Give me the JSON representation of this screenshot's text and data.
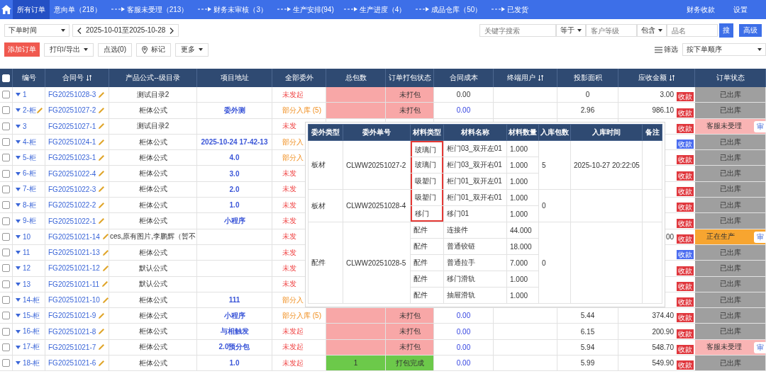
{
  "nav": {
    "tabs": [
      {
        "label": "所有订单",
        "selected": true,
        "arrow_before": false
      },
      {
        "label": "意向单（218）",
        "selected": false,
        "arrow_before": false
      },
      {
        "label": "客服未受理（213）",
        "selected": false,
        "arrow_before": true
      },
      {
        "label": "财务未审核（3）",
        "selected": false,
        "arrow_before": true
      },
      {
        "label": "生产安排(94)",
        "selected": false,
        "arrow_before": true
      },
      {
        "label": "生产进度（4）",
        "selected": false,
        "arrow_before": true
      },
      {
        "label": "成品仓库（50）",
        "selected": false,
        "arrow_before": true
      },
      {
        "label": "已发货",
        "selected": false,
        "arrow_before": true
      }
    ],
    "right_links": [
      "财务收款",
      "设置"
    ]
  },
  "filters": {
    "time_select": "下单时间",
    "date_range": "2025-10-01至2025-10-28",
    "keyword_placeholder": "关键字搜索",
    "op1": "等于",
    "level_placeholder": "客户等级",
    "op2": "包含",
    "name_placeholder": "品名",
    "search_button": "搜",
    "advanced_button": "高级"
  },
  "actions": {
    "add": "添加订单",
    "print": "打印/导出",
    "pick": "点选(0)",
    "mark": "标记",
    "more": "更多",
    "filter": "筛选",
    "sort": "按下单顺序"
  },
  "table": {
    "all_checked": false,
    "columns": [
      {
        "label": "编号",
        "sortable": false
      },
      {
        "label": "合同号",
        "sortable": true
      },
      {
        "label": "产品公式--级目录",
        "sortable": false
      },
      {
        "label": "项目地址",
        "sortable": false
      },
      {
        "label": "全部委外",
        "sortable": false
      },
      {
        "label": "总包数",
        "sortable": false
      },
      {
        "label": "订单打包状态",
        "sortable": false
      },
      {
        "label": "合同成本",
        "sortable": false
      },
      {
        "label": "终端用户",
        "sortable": true
      },
      {
        "label": "投影面积",
        "sortable": false
      },
      {
        "label": "应收金额",
        "sortable": true
      },
      {
        "label": "订单状态",
        "sortable": false
      }
    ],
    "rows": [
      {
        "checked": false,
        "no": "1",
        "editable": false,
        "contract": "FG20251028-3",
        "formula": "测试目录2",
        "outsource": {
          "text": "未发起",
          "kind": "pending"
        },
        "packages": {
          "kind": "unpacked"
        },
        "pack": {
          "text": "未打包",
          "kind": "unpacked"
        },
        "cost": {
          "text": "0.00",
          "kind": "plain"
        },
        "area": "0",
        "amount": "3.00",
        "pay": {
          "text": "收款",
          "color": "#e0383e"
        },
        "status": {
          "text": "已出库",
          "kind": "shipped"
        }
      },
      {
        "checked": false,
        "no": "2-柜",
        "editable": true,
        "contract": "FG20251027-2",
        "formula": "柜体公式",
        "address": "委外测",
        "outsource": {
          "text": "部分入库 (5)",
          "kind": "partial"
        },
        "packages": {
          "kind": "unpacked"
        },
        "pack": {
          "text": "未打包",
          "kind": "unpacked"
        },
        "cost": {
          "text": "0.00",
          "kind": "link"
        },
        "area": "2.96",
        "amount": "986.10",
        "pay": {
          "text": "收款",
          "color": "#e0383e"
        },
        "status": {
          "text": "已出库",
          "kind": "shipped"
        }
      },
      {
        "checked": false,
        "no": "3",
        "editable": false,
        "contract": "FG20251027-1",
        "formula": "测试目录2",
        "outsource": {
          "text": "未发",
          "kind": "pending"
        },
        "pay": {
          "text": "收款",
          "color": "#e0383e"
        },
        "status": {
          "text": "客服未受理",
          "kind": "waiting"
        },
        "action": "审"
      },
      {
        "checked": false,
        "no": "4-柜",
        "editable": false,
        "contract": "FG20251024-1",
        "formula": "柜体公式",
        "address": "2025-10-24 17-42-13",
        "outsource": {
          "text": "部分入",
          "kind": "partial"
        },
        "pay": {
          "text": "收款",
          "color": "#4a6cf0"
        },
        "status": {
          "text": "已出库",
          "kind": "shipped"
        }
      },
      {
        "checked": false,
        "no": "5-柜",
        "editable": false,
        "contract": "FG20251023-1",
        "formula": "柜体公式",
        "address": "4.0",
        "outsource": {
          "text": "部分入",
          "kind": "partial"
        },
        "pay": {
          "text": "收款",
          "color": "#e0383e"
        },
        "status": {
          "text": "已出库",
          "kind": "shipped"
        }
      },
      {
        "checked": false,
        "no": "6-柜",
        "editable": false,
        "contract": "FG20251022-4",
        "formula": "柜体公式",
        "address": "3.0",
        "outsource": {
          "text": "未发",
          "kind": "pending"
        },
        "pay": {
          "text": "收款",
          "color": "#e0383e"
        },
        "status": {
          "text": "已出库",
          "kind": "shipped"
        }
      },
      {
        "checked": false,
        "no": "7-柜",
        "editable": false,
        "contract": "FG20251022-3",
        "formula": "柜体公式",
        "address": "2.0",
        "outsource": {
          "text": "未发",
          "kind": "pending"
        },
        "pay": {
          "text": "收款",
          "color": "#e0383e"
        },
        "status": {
          "text": "已出库",
          "kind": "shipped"
        }
      },
      {
        "checked": false,
        "no": "8-柜",
        "editable": false,
        "contract": "FG20251022-2",
        "formula": "柜体公式",
        "address": "1.0",
        "outsource": {
          "text": "未发",
          "kind": "pending"
        },
        "pay": {
          "text": "收款",
          "color": "#e0383e"
        },
        "status": {
          "text": "已出库",
          "kind": "shipped"
        }
      },
      {
        "checked": false,
        "no": "9-柜",
        "editable": false,
        "contract": "FG20251022-1",
        "formula": "柜体公式",
        "address": "小程序",
        "outsource": {
          "text": "未发",
          "kind": "pending"
        },
        "pay": {
          "text": "收款",
          "color": "#e0383e"
        },
        "status": {
          "text": "已出库",
          "kind": "shipped"
        }
      },
      {
        "checked": false,
        "no": "10",
        "editable": false,
        "contract": "FG20251021-14",
        "formula": "ces,原有图片,李鹏辉（暂不",
        "outsource": {
          "text": "未发",
          "kind": "pending"
        },
        "amount": "00",
        "pay": {
          "text": "收款",
          "color": "#e0383e"
        },
        "status": {
          "text": "正在生产",
          "kind": "producing"
        },
        "action": "审"
      },
      {
        "checked": false,
        "no": "11",
        "editable": false,
        "contract": "FG20251021-13",
        "formula": "柜体公式",
        "outsource": {
          "text": "未发",
          "kind": "pending"
        },
        "pay": {
          "text": "收款",
          "color": "#4a6cf0"
        },
        "status": {
          "text": "已出库",
          "kind": "shipped"
        }
      },
      {
        "checked": false,
        "no": "12",
        "editable": false,
        "contract": "FG20251021-12",
        "formula": "默认公式",
        "outsource": {
          "text": "未发",
          "kind": "pending"
        },
        "pay": {
          "text": "收款",
          "color": "#e0383e"
        },
        "status": {
          "text": "已出库",
          "kind": "shipped"
        }
      },
      {
        "checked": false,
        "no": "13",
        "editable": false,
        "contract": "FG20251021-11",
        "formula": "默认公式",
        "outsource": {
          "text": "未发",
          "kind": "pending"
        },
        "pay": {
          "text": "收款",
          "color": "#e0383e"
        },
        "status": {
          "text": "已出库",
          "kind": "shipped"
        }
      },
      {
        "checked": false,
        "no": "14-柜",
        "editable": false,
        "contract": "FG20251021-10",
        "formula": "柜体公式",
        "address": "111",
        "outsource": {
          "text": "部分入",
          "kind": "partial"
        },
        "pay": {
          "text": "收款",
          "color": "#e0383e"
        },
        "status": {
          "text": "已出库",
          "kind": "shipped"
        }
      },
      {
        "checked": false,
        "no": "15-柜",
        "editable": false,
        "contract": "FG20251021-9",
        "formula": "柜体公式",
        "address": "小程序",
        "outsource": {
          "text": "部分入库 (5)",
          "kind": "partial"
        },
        "packages": {
          "kind": "unpacked"
        },
        "pack": {
          "text": "未打包",
          "kind": "unpacked"
        },
        "cost": {
          "text": "0.00",
          "kind": "link"
        },
        "area": "5.44",
        "amount": "374.40",
        "pay": {
          "text": "收款",
          "color": "#e0383e"
        },
        "status": {
          "text": "已出库",
          "kind": "shipped"
        }
      },
      {
        "checked": false,
        "no": "16-柜",
        "editable": false,
        "contract": "FG20251021-8",
        "formula": "柜体公式",
        "address": "与相触发",
        "outsource": {
          "text": "未发起",
          "kind": "pending"
        },
        "packages": {
          "kind": "unpacked"
        },
        "pack": {
          "text": "未打包",
          "kind": "unpacked"
        },
        "cost": {
          "text": "0.00",
          "kind": "link"
        },
        "area": "6.15",
        "amount": "200.90",
        "pay": {
          "text": "收款",
          "color": "#e0383e"
        },
        "status": {
          "text": "已出库",
          "kind": "shipped"
        }
      },
      {
        "checked": false,
        "no": "17-柜",
        "editable": false,
        "contract": "FG20251021-7",
        "formula": "柜体公式",
        "address": "2.0预分包",
        "outsource": {
          "text": "未发起",
          "kind": "pending"
        },
        "packages": {
          "kind": "unpacked"
        },
        "pack": {
          "text": "未打包",
          "kind": "unpacked"
        },
        "cost": {
          "text": "0.00",
          "kind": "link"
        },
        "area": "5.94",
        "amount": "548.70",
        "pay": {
          "text": "收款",
          "color": "#e0383e"
        },
        "status": {
          "text": "客服未受理",
          "kind": "waiting"
        },
        "action": "审"
      },
      {
        "checked": false,
        "no": "18-柜",
        "editable": false,
        "contract": "FG20251021-6",
        "formula": "柜体公式",
        "address": "1.0",
        "outsource": {
          "text": "未发起",
          "kind": "pending"
        },
        "packages": {
          "text": "1",
          "kind": "packed"
        },
        "pack": {
          "text": "打包完成",
          "kind": "packed"
        },
        "cost": {
          "text": "0.00",
          "kind": "link"
        },
        "area": "5.99",
        "amount": "549.90",
        "pay": {
          "text": "收款",
          "color": "#e0383e"
        },
        "status": {
          "text": "已出库",
          "kind": "shipped"
        }
      }
    ]
  },
  "outsource_popup": {
    "columns": [
      "委外类型",
      "委外单号",
      "材料类型",
      "材料名称",
      "材料数量",
      "入库包数",
      "入库时间",
      "备注"
    ],
    "groups": [
      {
        "type": "板材",
        "order": "CLWW20251027-2",
        "packages": "5",
        "time": "2025-10-27 20:22:05",
        "items": [
          {
            "material_type": "玻璃门",
            "name": "柜门03_双开左01",
            "qty": "1.000",
            "highlighted": true
          },
          {
            "material_type": "玻璃门",
            "name": "柜门03_双开右01",
            "qty": "1.000",
            "highlighted": true
          },
          {
            "material_type": "吸塑门",
            "name": "柜门01_双开左01",
            "qty": "1.000",
            "highlighted": true
          }
        ]
      },
      {
        "type": "板材",
        "order": "CLWW20251028-4",
        "packages": "0",
        "items": [
          {
            "material_type": "吸塑门",
            "name": "柜门01_双开右01",
            "qty": "1.000",
            "highlighted": true
          },
          {
            "material_type": "移门",
            "name": "移门01",
            "qty": "1.000",
            "highlighted": true
          }
        ]
      },
      {
        "type": "配件",
        "order": "CLWW20251028-5",
        "packages": "0",
        "items": [
          {
            "material_type": "配件",
            "name": "连接件",
            "qty": "44.000",
            "highlighted": false
          },
          {
            "material_type": "配件",
            "name": "普通铰链",
            "qty": "18.000",
            "highlighted": false
          },
          {
            "material_type": "配件",
            "name": "普通拉手",
            "qty": "7.000",
            "highlighted": false
          },
          {
            "material_type": "配件",
            "name": "移门滑轨",
            "qty": "1.000",
            "highlighted": false
          },
          {
            "material_type": "配件",
            "name": "抽屉滑轨",
            "qty": "1.000",
            "highlighted": false
          }
        ]
      }
    ]
  }
}
